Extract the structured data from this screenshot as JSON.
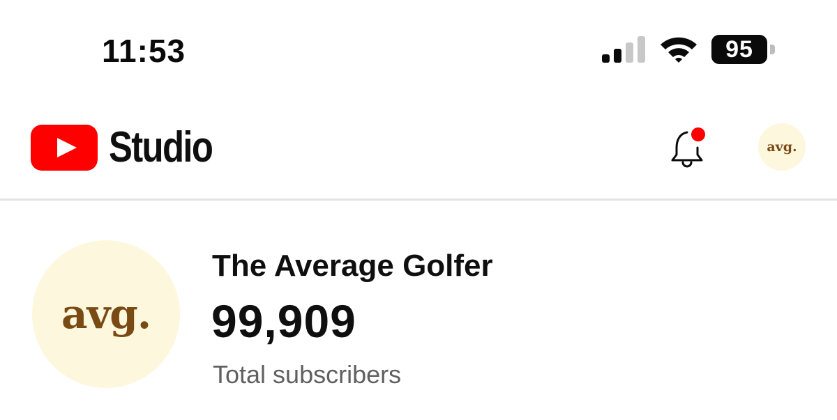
{
  "status_bar": {
    "time": "11:53",
    "battery_level": "95",
    "signal_bars_active": 2,
    "signal_bars_total": 4
  },
  "header": {
    "app_name": "Studio",
    "logo_icon": "youtube-play-icon",
    "notification_icon": "bell-icon",
    "has_unread_notification": true,
    "avatar_text": "avg."
  },
  "channel": {
    "avatar_text": "avg.",
    "name": "The Average Golfer",
    "subscriber_count": "99,909",
    "subscriber_label": "Total subscribers"
  },
  "colors": {
    "brand_red": "#ff0000",
    "avatar_bg": "#fdf7de",
    "avatar_text": "#7a4a14",
    "secondary_text": "#606060"
  }
}
